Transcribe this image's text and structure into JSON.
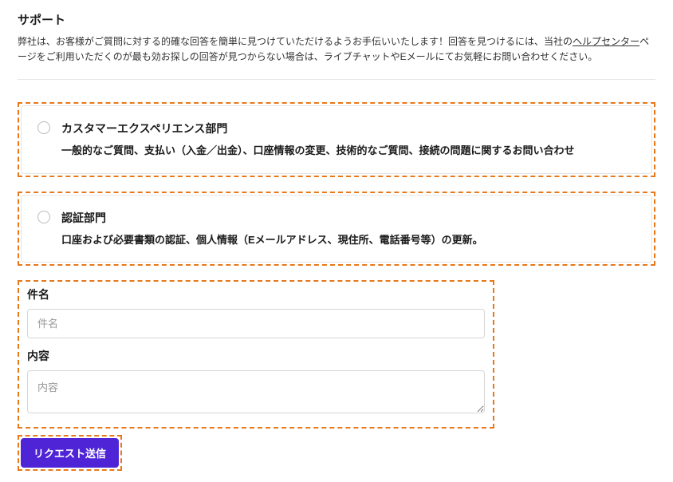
{
  "page": {
    "title": "サポート",
    "intro_pre": "弊社は、お客様がご質問に対する的確な回答を簡単に見つけていただけるようお手伝いいたします！回答を見つけるには、当社の",
    "intro_link": "ヘルプセンター",
    "intro_post": "ページをご利用いただくのが最も効お探しの回答が見つからない場合は、ライブチャットやEメールにてお気軽にお問い合わせください。"
  },
  "options": [
    {
      "title": "カスタマーエクスペリエンス部門",
      "desc": "一般的なご質問、支払い（入金／出金）、口座情報の変更、技術的なご質問、接続の問題に関するお問い合わせ"
    },
    {
      "title": "認証部門",
      "desc": "口座および必要書類の認証、個人情報（Eメールアドレス、現住所、電話番号等）の更新。"
    }
  ],
  "form": {
    "subject_label": "件名",
    "subject_placeholder": "件名",
    "content_label": "内容",
    "content_placeholder": "内容"
  },
  "submit": {
    "label": "リクエスト送信"
  }
}
